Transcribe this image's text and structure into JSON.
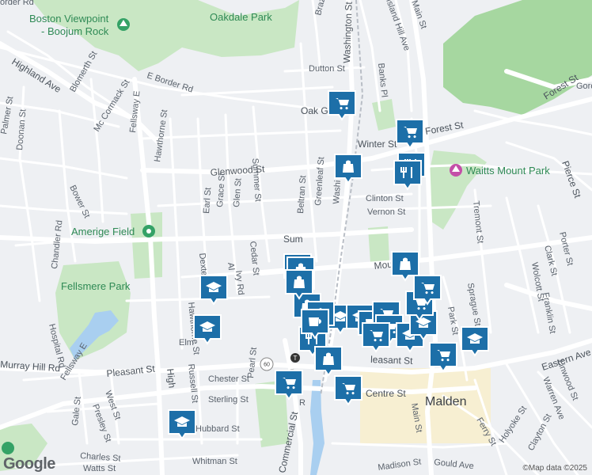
{
  "map": {
    "places": {
      "boston_viewpoint_1": "Boston Viewpoint",
      "boston_viewpoint_2": "- Boojum Rock",
      "oakdale_park": "Oakdale Park",
      "waitts_mount_park": "Waitts Mount Park",
      "amerige_field": "Amerige Field",
      "fellsmere_park": "Fellsmere Park",
      "malden": "Malden"
    },
    "streets": {
      "border_rd": "order Rd",
      "highland_ave": "Highland Ave",
      "blomerth_st": "Blomerth St",
      "e_border_rd": "E Border Rd",
      "mccormack_st": "Mc Cormack St",
      "palmer_st": "Palmer St",
      "doonan_st": "Doonan St",
      "fellsway_e_top": "Fellsway E",
      "hawthorne_st_top": "Hawthorne St",
      "summer_st": "Summer St",
      "glenwood_st": "Glenwood St",
      "earl_st": "Earl St",
      "grace_st": "Grace St",
      "glen_st": "Glen St",
      "beltran_st": "Beltran St",
      "greenleaf_st": "Greenleaf St",
      "washington_st_top": "Washington St",
      "washington_st_mid": "Washi",
      "brazil": "Braz",
      "dutton_st": "Dutton St",
      "oak_grove": "Oak G",
      "banks_pl": "Banks Pl",
      "winter_st": "Winter St",
      "forest_st_mid": "Forest St",
      "forest_st_right": "Forest St",
      "gordon": "Gord",
      "island_hill_ave": "Island Hill Ave",
      "main_st_top": "Main St",
      "pierce_st": "Pierce St",
      "clinton_st": "Clinton St",
      "vernon_st": "Vernon St",
      "bower_st": "Bower St",
      "chandler_rd": "Chandler Rd",
      "dexter": "Dexte",
      "cedar_st": "Cedar St",
      "ivy_rd": "Ivy Rd",
      "al": "Al",
      "sum": "Sum",
      "mountain": "Mount",
      "hawthorne_st_bot": "Hawthorne St",
      "hospital_rd": "Hospital Rd",
      "tremont_st": "Tremont St",
      "porter_st": "Porter St",
      "clark_st": "Clark St",
      "wolcott_st": "Wolcott St",
      "sprague_st": "Sprague St",
      "franklin_st": "Franklin St",
      "park_st": "Park St",
      "elm": "Elm",
      "murray_hill_rd": "Murray Hill Rd",
      "fellsway_e_bot": "Fellsway E",
      "pleasant_st_left": "Pleasant St",
      "pleasant_st_right": "leasant St",
      "high": "High",
      "chester_st": "Chester St",
      "russell_st": "Russell St",
      "pearl_st": "Pearl St",
      "sterling_st": "Sterling St",
      "commercial_st": "Commercial St",
      "centre_st": "Centre St",
      "main_st_bot": "Main St",
      "eastern_ave": "Eastern Ave",
      "linwood_st": "Linwood St",
      "warren_ave": "Warren Ave",
      "holyoke_st": "Holyoke St",
      "clayton_st": "Clayton St",
      "ferry_st": "Ferry St",
      "gale_st": "Gale St",
      "presley_st": "Presley St",
      "west_st": "West St",
      "hubbard_st": "Hubbard St",
      "charles_st": "Charles St",
      "watts_st": "Watts St",
      "whitman_st": "Whitman St",
      "madison_st": "Madison St",
      "gould_ave": "Gould Ave",
      "r": "R",
      "rt_60_a": "60",
      "rt_60_b": "60"
    },
    "attribution": "©Map data ©2025",
    "logo": "Google",
    "colors": {
      "land": "#eef0f3",
      "road": "#ffffff",
      "park": "#c9e7c4",
      "park_dark": "#a6d7a0",
      "water": "#a9cff0",
      "downtown": "#f7efd2",
      "marker": "#1d6fa8"
    },
    "markers": [
      {
        "type": "grocery",
        "icon": "shopping-cart-icon"
      },
      {
        "type": "grocery",
        "icon": "shopping-cart-icon"
      },
      {
        "type": "shopping",
        "icon": "shopping-bag-icon"
      },
      {
        "type": "restaurant",
        "icon": "restaurant-icon"
      },
      {
        "type": "shopping",
        "icon": "shopping-bag-icon"
      },
      {
        "type": "school",
        "icon": "graduation-cap-icon"
      },
      {
        "type": "school",
        "icon": "graduation-cap-icon"
      },
      {
        "type": "cafe",
        "icon": "coffee-cup-icon"
      },
      {
        "type": "grocery",
        "icon": "shopping-cart-icon"
      },
      {
        "type": "grocery",
        "icon": "shopping-cart-icon"
      },
      {
        "type": "school",
        "icon": "graduation-cap-icon"
      },
      {
        "type": "school",
        "icon": "graduation-cap-icon"
      },
      {
        "type": "grocery",
        "icon": "shopping-cart-icon"
      }
    ]
  }
}
